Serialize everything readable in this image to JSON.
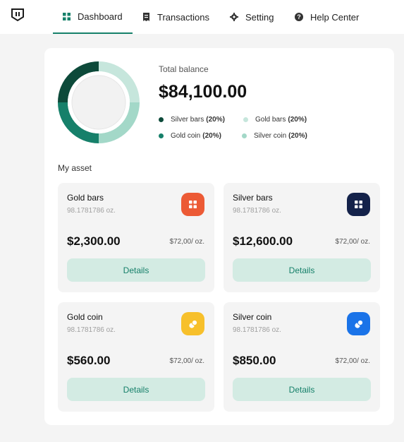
{
  "nav": {
    "items": [
      {
        "label": "Dashboard",
        "icon": "grid-icon",
        "active": true
      },
      {
        "label": "Transactions",
        "icon": "receipt-icon",
        "active": false
      },
      {
        "label": "Setting",
        "icon": "gear-icon",
        "active": false
      },
      {
        "label": "Help Center",
        "icon": "question-circle-icon",
        "active": false
      }
    ]
  },
  "balance": {
    "label": "Total balance",
    "value": "$84,100.00"
  },
  "chart_data": {
    "type": "pie",
    "categories": [
      "Silver bars",
      "Gold bars",
      "Gold coin",
      "Silver coin"
    ],
    "values": [
      20,
      20,
      20,
      20
    ],
    "colors": [
      "#0d4a3a",
      "#c6e6dc",
      "#16806a",
      "#a3d8c8"
    ]
  },
  "legend": [
    {
      "label": "Silver bars",
      "pct": "(20%)",
      "color": "#0d4a3a"
    },
    {
      "label": "Gold bars",
      "pct": "(20%)",
      "color": "#c6e6dc"
    },
    {
      "label": "Gold coin",
      "pct": "(20%)",
      "color": "#16806a"
    },
    {
      "label": "Silver coin",
      "pct": "(20%)",
      "color": "#a3d8c8"
    }
  ],
  "section_title": "My asset",
  "assets": [
    {
      "name": "Gold bars",
      "qty": "98.1781786 oz.",
      "value": "$2,300.00",
      "rate": "$72,00/ oz.",
      "button": "Details",
      "icon": "grid-icon",
      "icon_color": "#ec5a35"
    },
    {
      "name": "Silver bars",
      "qty": "98.1781786 oz.",
      "value": "$12,600.00",
      "rate": "$72,00/ oz.",
      "button": "Details",
      "icon": "grid-icon",
      "icon_color": "#14224a"
    },
    {
      "name": "Gold coin",
      "qty": "98.1781786 oz.",
      "value": "$560.00",
      "rate": "$72,00/ oz.",
      "button": "Details",
      "icon": "coins-icon",
      "icon_color": "#f7c02b"
    },
    {
      "name": "Silver coin",
      "qty": "98.1781786 oz.",
      "value": "$850.00",
      "rate": "$72,00/ oz.",
      "button": "Details",
      "icon": "coins-icon",
      "icon_color": "#1a73e8"
    }
  ]
}
